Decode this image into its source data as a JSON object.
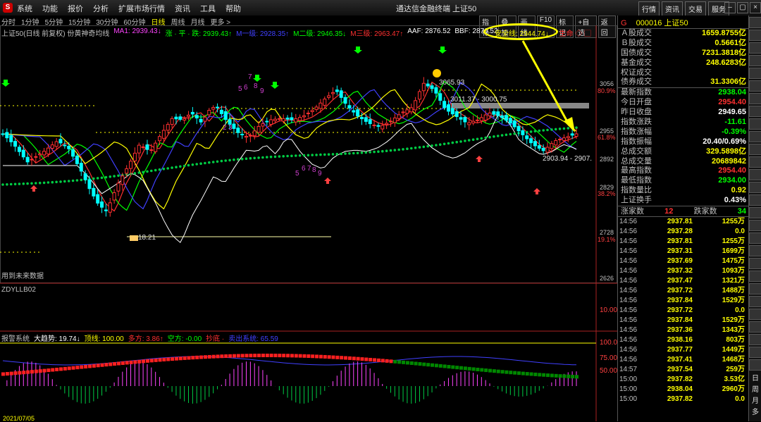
{
  "menubar": {
    "logo": "S",
    "items": [
      "系统",
      "功能",
      "报价",
      "分析",
      "扩展市场行情",
      "资讯",
      "工具",
      "帮助"
    ],
    "window_title": "通达信金融终端  上证50",
    "right_buttons": [
      "行情",
      "资讯",
      "交易",
      "服务"
    ],
    "window_buttons": [
      "–",
      "▢",
      "×"
    ]
  },
  "periodbar": {
    "periods": [
      "分时",
      "1分钟",
      "5分钟",
      "15分钟",
      "30分钟",
      "60分钟",
      "日线",
      "周线",
      "月线",
      "更多 >"
    ],
    "active": "日线",
    "tools": [
      "指标",
      "叠加",
      "画线",
      "F10",
      "标记",
      "+自选",
      "返回"
    ]
  },
  "legend": [
    {
      "text": "上证50(日线 前复权) 份黄神奇均线",
      "color": "#c0c0c0"
    },
    {
      "text": "MA1: 2939.43↓",
      "color": "#ff44ff"
    },
    {
      "text": "涨 · 平 · 跌: 2939.43↑",
      "color": "#00ff00"
    },
    {
      "text": "M一级: 2928.35↑",
      "color": "#4040ff"
    },
    {
      "text": "M二级: 2946.35↓",
      "color": "#00ff00"
    },
    {
      "text": "M三级: 2963.47↑",
      "color": "#ff3030"
    },
    {
      "text": "AAF: 2876.52",
      "color": "#ffffff"
    },
    {
      "text": "BBF: 2876.52",
      "color": "#ffffff"
    }
  ],
  "safety_line": "安全线: 2944.74↓",
  "safety_tail": "生命 ◇ ▢",
  "price_axis": [
    {
      "label": "3056",
      "color": "#c0c0c0"
    },
    {
      "label": "80.9%",
      "color": "#ff4040"
    },
    {
      "label": "2955",
      "color": "#c0c0c0"
    },
    {
      "label": "61.8%",
      "color": "#ff4040"
    },
    {
      "label": "2892",
      "color": "#c0c0c0"
    },
    {
      "label": "2829",
      "color": "#c0c0c0"
    },
    {
      "label": "38.2%",
      "color": "#ff4040"
    },
    {
      "label": "2728",
      "color": "#c0c0c0"
    },
    {
      "label": "19.1%",
      "color": "#ff4040"
    },
    {
      "label": "2626",
      "color": "#c0c0c0"
    }
  ],
  "annotations": {
    "high": "3065.93",
    "low": "18.21",
    "range1": "3011.37 - 3000.75",
    "range2": "2903.94 - 2907.",
    "future_note": "用到未来数据",
    "numbers": [
      "7",
      "5",
      "6",
      "8",
      "9",
      "2",
      "3",
      "5",
      "6",
      "7",
      "8",
      "9"
    ]
  },
  "indicator1": {
    "name": "ZDYLLB02",
    "axis": "10.00"
  },
  "indicator2": {
    "legend": [
      {
        "text": "报警系统",
        "color": "#c0c0c0"
      },
      {
        "text": "大趋势: 19.74↓",
        "color": "#ffffff"
      },
      {
        "text": "顶线: 100.00",
        "color": "#ffff00"
      },
      {
        "text": "多方: 3.86↑",
        "color": "#ff3030"
      },
      {
        "text": "空方: -0.00",
        "color": "#00ff00"
      },
      {
        "text": "抄底 ·",
        "color": "#ff3030"
      },
      {
        "text": "卖出系统: 65.59",
        "color": "#4040ff"
      }
    ],
    "axis": [
      "100.0",
      "75.00",
      "50.00"
    ],
    "date_label": "2021/07/05"
  },
  "quote": {
    "code": "000016",
    "name": "上证50",
    "g_label": "G",
    "stats": [
      {
        "k": "Ａ股成交",
        "v": "1659.8755亿",
        "c": "#ffff00"
      },
      {
        "k": "Ｂ股成交",
        "v": "0.5661亿",
        "c": "#ffff00"
      },
      {
        "k": "国债成交",
        "v": "7231.3818亿",
        "c": "#ffff00"
      },
      {
        "k": "基金成交",
        "v": "248.6283亿",
        "c": "#ffff00"
      },
      {
        "k": "权证成交",
        "v": "",
        "c": "#ffff00"
      },
      {
        "k": "债券成交",
        "v": "31.3306亿",
        "c": "#ffff00"
      },
      {
        "k": "最新指数",
        "v": "2938.04",
        "c": "#00ff00"
      },
      {
        "k": "今日开盘",
        "v": "2954.40",
        "c": "#ff3030"
      },
      {
        "k": "昨日收盘",
        "v": "2949.65",
        "c": "#ffffff"
      },
      {
        "k": "指数涨跌",
        "v": "-11.61",
        "c": "#00ff00"
      },
      {
        "k": "指数涨幅",
        "v": "-0.39%",
        "c": "#00ff00"
      },
      {
        "k": "指数振幅",
        "v": "20.40/0.69%",
        "c": "#ffffff"
      },
      {
        "k": "总成交额",
        "v": "329.5898亿",
        "c": "#ffff00"
      },
      {
        "k": "总成交量",
        "v": "20689842",
        "c": "#ffff00"
      },
      {
        "k": "最高指数",
        "v": "2954.40",
        "c": "#ff3030"
      },
      {
        "k": "最低指数",
        "v": "2934.00",
        "c": "#00ff00"
      },
      {
        "k": "指数量比",
        "v": "0.92",
        "c": "#ffff00"
      },
      {
        "k": "上证换手",
        "v": "0.43%",
        "c": "#ffffff"
      }
    ],
    "advance_label": "涨家数",
    "advance": "12",
    "decline_label": "跌家数",
    "decline": "34",
    "ticks": [
      {
        "t": "14:56",
        "p": "2937.81",
        "q": "1255万"
      },
      {
        "t": "14:56",
        "p": "2937.28",
        "q": "0.0"
      },
      {
        "t": "14:56",
        "p": "2937.81",
        "q": "1255万"
      },
      {
        "t": "14:56",
        "p": "2937.31",
        "q": "1699万"
      },
      {
        "t": "14:56",
        "p": "2937.69",
        "q": "1475万"
      },
      {
        "t": "14:56",
        "p": "2937.32",
        "q": "1093万"
      },
      {
        "t": "14:56",
        "p": "2937.47",
        "q": "1321万"
      },
      {
        "t": "14:56",
        "p": "2937.72",
        "q": "1488万"
      },
      {
        "t": "14:56",
        "p": "2937.84",
        "q": "1529万"
      },
      {
        "t": "14:56",
        "p": "2937.72",
        "q": "0.0"
      },
      {
        "t": "14:56",
        "p": "2937.84",
        "q": "1529万"
      },
      {
        "t": "14:56",
        "p": "2937.36",
        "q": "1343万"
      },
      {
        "t": "14:56",
        "p": "2938.16",
        "q": "803万"
      },
      {
        "t": "14:56",
        "p": "2937.77",
        "q": "1449万"
      },
      {
        "t": "14:56",
        "p": "2937.41",
        "q": "1468万"
      },
      {
        "t": "14:57",
        "p": "2937.54",
        "q": "259万"
      },
      {
        "t": "15:00",
        "p": "2937.82",
        "q": "3.53亿"
      },
      {
        "t": "15:00",
        "p": "2938.04",
        "q": "2960万"
      },
      {
        "t": "15:00",
        "p": "2937.82",
        "q": "0.0"
      }
    ]
  },
  "sidebar_chars": [
    "日",
    "周",
    "月",
    "多"
  ]
}
